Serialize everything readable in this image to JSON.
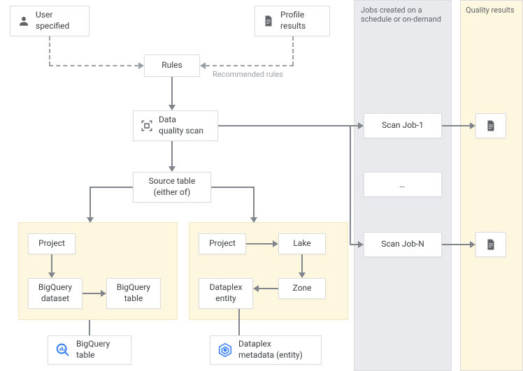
{
  "nodes": {
    "user_specified": "User\nspecified",
    "profile_results": "Profile\nresults",
    "rules": "Rules",
    "recommended_rules_caption": "Recommended rules",
    "data_quality_scan": "Data\nquality scan",
    "source_table": "Source table\n(either of)",
    "left": {
      "project": "Project",
      "bq_dataset": "BigQuery\ndataset",
      "bq_table": "BigQuery\ntable",
      "bq_table_icon": "BigQuery\ntable"
    },
    "right": {
      "project": "Project",
      "lake": "Lake",
      "zone": "Zone",
      "dataplex_entity": "Dataplex\nentity",
      "dataplex_metadata": "Dataplex\nmetadata (entity)"
    },
    "jobs": {
      "label": "Jobs created on a\nschedule or on-demand",
      "job1": "Scan Job-1",
      "ellipsis": "…",
      "jobN": "Scan Job-N"
    },
    "results": {
      "label": "Quality results"
    }
  },
  "icons": {
    "user": "user-icon",
    "doc": "document-icon",
    "scan": "scan-icon",
    "bigquery": "bigquery-icon",
    "dataplex": "dataplex-icon"
  }
}
